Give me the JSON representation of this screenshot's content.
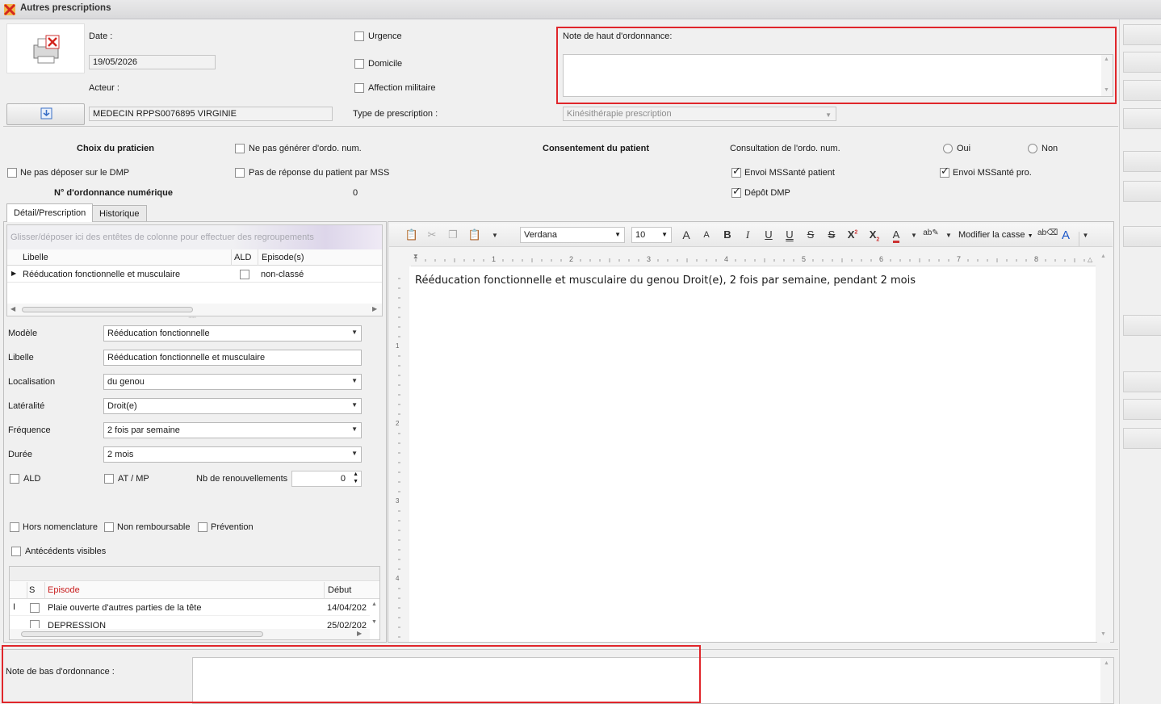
{
  "window": {
    "title": "Autres prescriptions"
  },
  "header": {
    "date_label": "Date :",
    "date_value": "19/05/2026",
    "acteur_label": "Acteur :",
    "acteur_value": "MEDECIN RPPS0076895 VIRGINIE",
    "urgence_label": "Urgence",
    "domicile_label": "Domicile",
    "affection_label": "Affection militaire",
    "type_label": "Type de prescription :",
    "type_value": "Kinésithérapie prescription",
    "note_haut_label": "Note de haut d'ordonnance:",
    "note_haut_value": ""
  },
  "options": {
    "choix_praticien": "Choix du praticien",
    "ne_pas_generer": "Ne pas générer d'ordo. num.",
    "consentement": "Consentement du patient",
    "consultation": "Consultation de l'ordo. num.",
    "oui": "Oui",
    "non": "Non",
    "ne_pas_deposer": "Ne pas déposer sur le DMP",
    "pas_reponse": "Pas de réponse du patient par MSS",
    "envoi_patient": "Envoi MSSanté patient",
    "envoi_pro": "Envoi MSSanté pro.",
    "num_ordo_label": "N° d'ordonnance numérique",
    "num_ordo_value": "0",
    "depot_dmp": "Dépôt DMP"
  },
  "tabs": [
    "Détail/Prescription",
    "Historique"
  ],
  "grid": {
    "group_hint": "Glisser/déposer ici des entêtes de colonne pour effectuer des regroupements",
    "columns": [
      "Libelle",
      "ALD",
      "Episode(s)"
    ],
    "rows": [
      {
        "libelle": "Rééducation fonctionnelle et musculaire",
        "episode": "non-classé"
      }
    ]
  },
  "form": {
    "modele_label": "Modèle",
    "modele_value": "Rééducation fonctionnelle",
    "libelle_label": "Libelle",
    "libelle_value": "Rééducation fonctionnelle et musculaire",
    "localisation_label": "Localisation",
    "localisation_value": "du genou",
    "lateralite_label": "Latéralité",
    "lateralite_value": "Droit(e)",
    "frequence_label": "Fréquence",
    "frequence_value": "2 fois par semaine",
    "duree_label": "Durée",
    "duree_value": "2 mois",
    "ald_label": "ALD",
    "atmp_label": "AT / MP",
    "renouv_label": "Nb de renouvellements",
    "renouv_value": "0",
    "hors_nomenclature": "Hors nomenclature",
    "non_remboursable": "Non remboursable",
    "prevention": "Prévention",
    "antecedents": "Antécédents visibles"
  },
  "episodes": {
    "columns": [
      "S",
      "Episode",
      "Début"
    ],
    "rows": [
      {
        "episode": "Plaie ouverte d'autres parties de la tête",
        "debut": "14/04/202"
      },
      {
        "episode": "DEPRESSION",
        "debut": "25/02/202"
      }
    ]
  },
  "editor": {
    "font": "Verdana",
    "size": "10",
    "modifier_casse": "Modifier la casse",
    "content": "Rééducation fonctionnelle et musculaire du genou Droit(e), 2 fois par semaine, pendant 2 mois",
    "ruler_marks": [
      "1",
      "2",
      "3",
      "4",
      "5",
      "6",
      "7",
      "8"
    ],
    "vruler_marks": [
      "1",
      "2",
      "3",
      "4"
    ]
  },
  "footer": {
    "note_bas_label": "Note de bas d'ordonnance :",
    "note_bas_value": ""
  },
  "colors": {
    "highlight_red": "#e0262b",
    "episode_header": "#c81e1e",
    "link_blue": "#1a56c8"
  }
}
